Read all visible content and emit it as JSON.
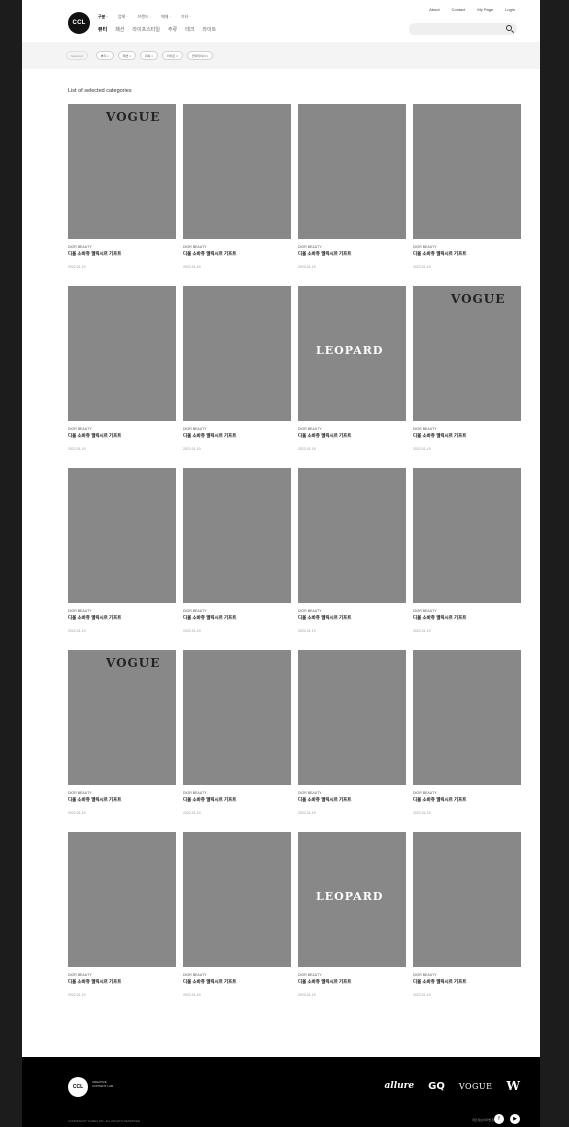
{
  "header": {
    "logo": "CCL",
    "utility": [
      "About",
      "Contact",
      "My Page",
      "Login"
    ],
    "categories": [
      "구분 ·",
      "업체 ·",
      "브랜드 ·",
      "매체 ·",
      "기타 ·"
    ],
    "subnav": [
      "뷰티",
      "패션",
      "라이프스타일",
      "주류",
      "테크",
      "라이트"
    ],
    "search_placeholder": ""
  },
  "filters": [
    "Selected",
    "뷰티 ×",
    "패션 ×",
    "럭셔 ×",
    "라이프 ×",
    "언더마이너 ×"
  ],
  "list_title": "List of selected categories",
  "cards": [
    {
      "source": "DIOR BEAUTY",
      "title": "디올 소바쥬 엘릭시르 기프트",
      "date": "2022.01.19",
      "theme": "t1",
      "overlay": "VOGUE"
    },
    {
      "source": "DIOR BEAUTY",
      "title": "디올 소바쥬 엘릭시르 기프트",
      "date": "2022.01.19",
      "theme": "t2",
      "overlay": ""
    },
    {
      "source": "DIOR BEAUTY",
      "title": "디올 소바쥬 엘릭시르 기프트",
      "date": "2022.01.19",
      "theme": "t3",
      "overlay": ""
    },
    {
      "source": "DIOR BEAUTY",
      "title": "디올 소바쥬 엘릭시르 기프트",
      "date": "2022.01.19",
      "theme": "t4",
      "overlay": ""
    },
    {
      "source": "DIOR BEAUTY",
      "title": "디올 소바쥬 엘릭시르 기프트",
      "date": "2022.01.19",
      "theme": "t5",
      "overlay": ""
    },
    {
      "source": "DIOR BEAUTY",
      "title": "디올 소바쥬 엘릭시르 기프트",
      "date": "2022.01.19",
      "theme": "t6",
      "overlay": ""
    },
    {
      "source": "DIOR BEAUTY",
      "title": "디올 소바쥬 엘릭시르 기프트",
      "date": "2022.01.19",
      "theme": "t7",
      "overlay": "LEOPARD"
    },
    {
      "source": "DIOR BEAUTY",
      "title": "디올 소바쥬 엘릭시르 기프트",
      "date": "2022.01.19",
      "theme": "t8",
      "overlay": "VOGUE"
    },
    {
      "source": "DIOR BEAUTY",
      "title": "디올 소바쥬 엘릭시르 기프트",
      "date": "2022.01.19",
      "theme": "t9",
      "overlay": ""
    },
    {
      "source": "DIOR BEAUTY",
      "title": "디올 소바쥬 엘릭시르 기프트",
      "date": "2022.01.19",
      "theme": "t10",
      "overlay": ""
    },
    {
      "source": "DIOR BEAUTY",
      "title": "디올 소바쥬 엘릭시르 기프트",
      "date": "2022.01.19",
      "theme": "t11",
      "overlay": ""
    },
    {
      "source": "DIOR BEAUTY",
      "title": "디올 소바쥬 엘릭시르 기프트",
      "date": "2022.01.19",
      "theme": "t12",
      "overlay": ""
    },
    {
      "source": "DIOR BEAUTY",
      "title": "디올 소바쥬 엘릭시르 기프트",
      "date": "2022.01.19",
      "theme": "t1",
      "overlay": "VOGUE"
    },
    {
      "source": "DIOR BEAUTY",
      "title": "디올 소바쥬 엘릭시르 기프트",
      "date": "2022.01.19",
      "theme": "t2",
      "overlay": ""
    },
    {
      "source": "DIOR BEAUTY",
      "title": "디올 소바쥬 엘릭시르 기프트",
      "date": "2022.01.19",
      "theme": "t3",
      "overlay": ""
    },
    {
      "source": "DIOR BEAUTY",
      "title": "디올 소바쥬 엘릭시르 기프트",
      "date": "2022.01.19",
      "theme": "t4",
      "overlay": ""
    },
    {
      "source": "DIOR BEAUTY",
      "title": "디올 소바쥬 엘릭시르 기프트",
      "date": "2022.01.19",
      "theme": "t5",
      "overlay": ""
    },
    {
      "source": "DIOR BEAUTY",
      "title": "디올 소바쥬 엘릭시르 기프트",
      "date": "2022.01.19",
      "theme": "t6",
      "overlay": ""
    },
    {
      "source": "DIOR BEAUTY",
      "title": "디올 소바쥬 엘릭시르 기프트",
      "date": "2022.01.19",
      "theme": "t7",
      "overlay": "LEOPARD"
    },
    {
      "source": "DIOR BEAUTY",
      "title": "디올 소바쥬 엘릭시르 기프트",
      "date": "2022.01.19",
      "theme": "t8",
      "overlay": ""
    }
  ],
  "footer": {
    "logo": "CCL",
    "tagline": "CREATIVE CONTENT LAB",
    "brands": [
      "allure",
      "GQ",
      "VOGUE",
      "W"
    ],
    "copyright": "CONDENAST KOREA INC. ALL RIGHTS RESERVED",
    "follow": "개인정보처리방침",
    "social": [
      "f",
      "▶"
    ]
  }
}
